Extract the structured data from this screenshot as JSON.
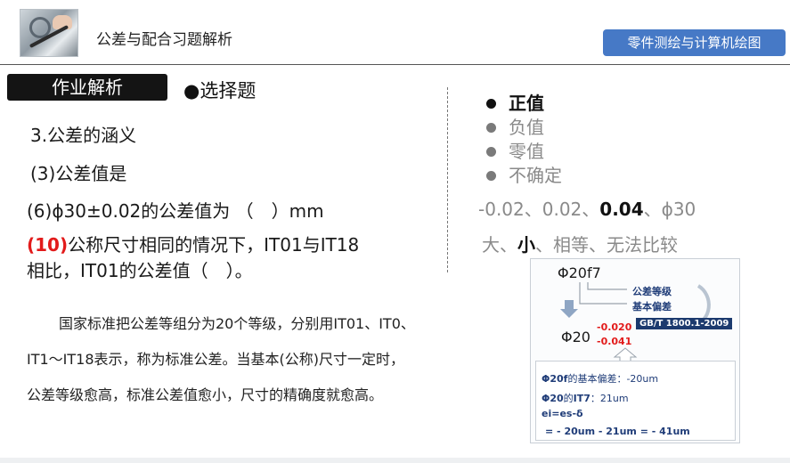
{
  "header": {
    "title": "公差与配合习题解析",
    "course_button": "零件测绘与计算机绘图"
  },
  "section": {
    "tab_label": "作业解析",
    "type_label": "●选择题"
  },
  "questions": {
    "q1": "3.公差的涵义",
    "q2": "(3)公差值是",
    "q3": "(6)ϕ30±0.02的公差值为 （　）mm",
    "q4_num": "(10)",
    "q4_line1": "公称尺寸相同的情况下，IT01与IT18",
    "q4_line2": "相比，IT01的公差值（　）。"
  },
  "explanation": {
    "line1": "国家标准把公差等组分为20个等级，分别用IT01、IT0、",
    "line2": "IT1～IT18表示，称为标准公差。当基本(公称)尺寸一定时，",
    "line3": "公差等级愈高，标准公差值愈小，尺寸的精确度就愈高。"
  },
  "options": [
    {
      "label": "正值",
      "selected": true
    },
    {
      "label": "负值",
      "selected": false
    },
    {
      "label": "零值",
      "selected": false
    },
    {
      "label": "不确定",
      "selected": false
    }
  ],
  "answers_q6": {
    "a": "-0.02、",
    "b": "0.02、",
    "c": "0.04",
    "d": "、ϕ30"
  },
  "answers_q10": {
    "a": "大、",
    "b": "小",
    "c": "、相等、无法比较"
  },
  "diagram": {
    "designation": "Φ20f7",
    "label_grade": "公差等级",
    "label_deviation": "基本偏差",
    "standard": "GB/T 1800.1-2009",
    "base": "Φ20",
    "upper_dev": "-0.020",
    "lower_dev": "-0.041",
    "calc1_head": "Φ20f",
    "calc1_tail": "的基本偏差：-20um",
    "calc2_head": "Φ20",
    "calc2_mid": "的",
    "calc2_it": "IT7",
    "calc2_tail": "：21um",
    "calc3": "ei=es-δ",
    "calc4": "= - 20um - 21um = - 41um"
  },
  "colors": {
    "accent_blue": "#4679c6",
    "tab_black": "#141414",
    "highlight_red": "#e21b1b",
    "navy": "#1c3a6e"
  }
}
